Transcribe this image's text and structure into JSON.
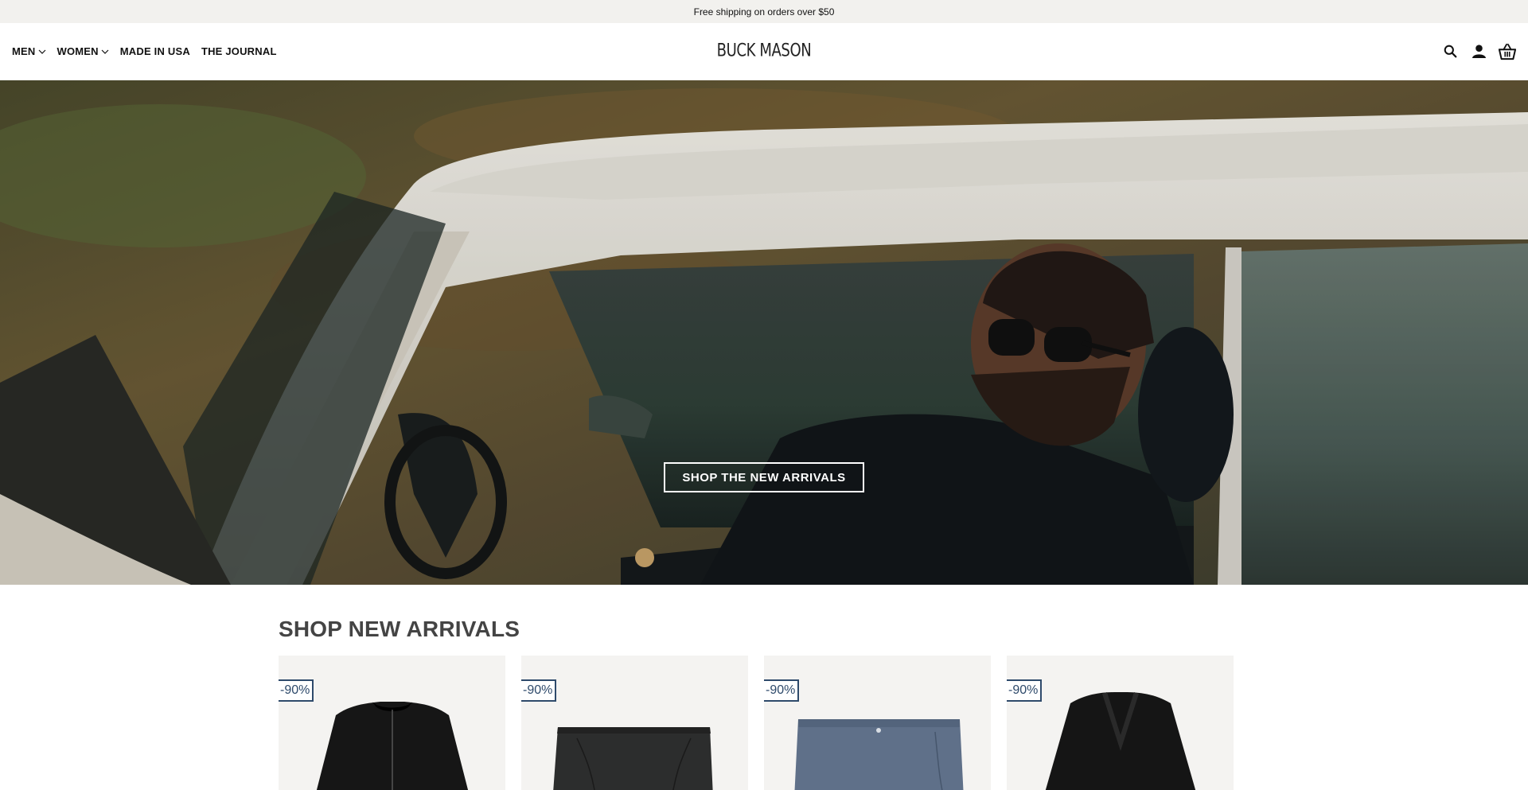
{
  "announcement": "Free shipping on orders over $50",
  "nav": [
    {
      "label": "MEN",
      "dropdown": true
    },
    {
      "label": "WOMEN",
      "dropdown": true
    },
    {
      "label": "MADE IN USA",
      "dropdown": false
    },
    {
      "label": "THE JOURNAL",
      "dropdown": false
    }
  ],
  "logo": "BUCK MASON",
  "header_icons": [
    "search-icon",
    "account-icon",
    "cart-icon"
  ],
  "hero": {
    "cta": "SHOP THE NEW ARRIVALS"
  },
  "new_arrivals": {
    "title": "SHOP NEW ARRIVALS",
    "products": [
      {
        "badge": "-90%",
        "image": "black-bomber-jacket"
      },
      {
        "badge": "-90%",
        "image": "charcoal-shorts"
      },
      {
        "badge": "-90%",
        "image": "slate-blue-shorts"
      },
      {
        "badge": "-90%",
        "image": "black-blazer"
      }
    ]
  },
  "colors": {
    "accent": "#2e4a6b",
    "announcement_bg": "#f2f1ee",
    "card_bg": "#f4f3f1"
  }
}
